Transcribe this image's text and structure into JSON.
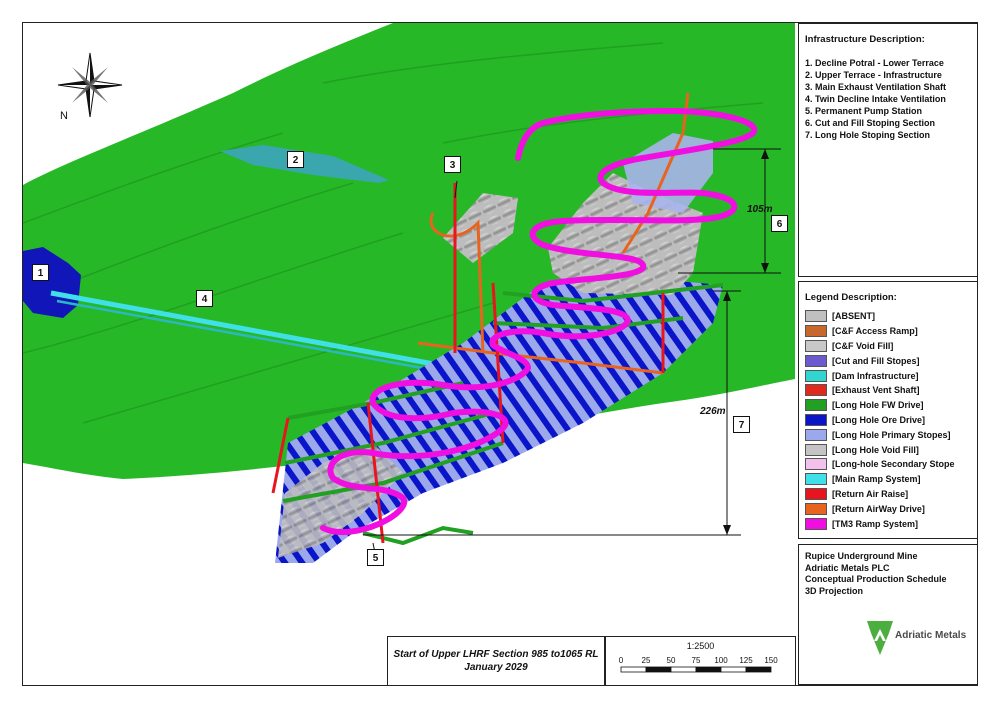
{
  "infrastructure": {
    "title": "Infrastructure Description:",
    "items": [
      "1. Decline Potral - Lower Terrace",
      "2. Upper Terrace - Infrastructure",
      "3. Main Exhaust Ventilation Shaft",
      "4. Twin Decline Intake Ventilation",
      "5. Permanent Pump Station",
      "6. Cut and Fill Stoping Section",
      "7. Long Hole Stoping Section"
    ]
  },
  "legend": {
    "title": "Legend Description:",
    "items": [
      {
        "label": "[ABSENT]",
        "color": "#c0c0c0"
      },
      {
        "label": "[C&F Access Ramp]",
        "color": "#c8682a"
      },
      {
        "label": "[C&F Void Fill]",
        "color": "#c8c8c8"
      },
      {
        "label": "[Cut and Fill Stopes]",
        "color": "#6a5acd"
      },
      {
        "label": "[Dam Infrastructure]",
        "color": "#30d6d0"
      },
      {
        "label": "[Exhaust Vent Shaft]",
        "color": "#e0281e"
      },
      {
        "label": "[Long Hole FW Drive]",
        "color": "#22a022"
      },
      {
        "label": "[Long Hole Ore Drive]",
        "color": "#0a14c8"
      },
      {
        "label": "[Long Hole Primary Stopes]",
        "color": "#9ca8ec"
      },
      {
        "label": "[Long Hole Void Fill]",
        "color": "#c4c4c4"
      },
      {
        "label": "[Long-hole Secondary Stope",
        "color": "#f2c2ec"
      },
      {
        "label": "[Main Ramp System]",
        "color": "#40e0e8"
      },
      {
        "label": "[Return Air Raise]",
        "color": "#e8141e"
      },
      {
        "label": "[Return AirWay Drive]",
        "color": "#e8641e"
      },
      {
        "label": "[TM3 Ramp System]",
        "color": "#f00ee0"
      }
    ]
  },
  "company": {
    "lines": [
      "Rupice Underground Mine",
      "Adriatic Metals PLC",
      "Conceptual Production Schedule",
      "3D Projection"
    ],
    "logo_text": "Adriatic Metals"
  },
  "title_block": {
    "line1": "Start of Upper LHRF Section 985 to1065 RL",
    "line2": "January 2029"
  },
  "scale": {
    "label": "1:2500",
    "ticks": [
      "0",
      "25",
      "50",
      "75",
      "100",
      "125",
      "150"
    ]
  },
  "map": {
    "north_label": "N",
    "callouts": [
      "1",
      "2",
      "3",
      "4",
      "5",
      "6",
      "7"
    ],
    "dimension_cf": "105m",
    "dimension_lh": "226m"
  },
  "colors": {
    "terrain": "#27b827",
    "terrain_dark": "#1f9a1f",
    "tm3_ramp": "#f00ee0",
    "main_ramp": "#40e0e8",
    "ore_drive": "#0a14c8",
    "fw_drive": "#22a022",
    "return_air": "#e8141e",
    "access_ramp": "#c8682a",
    "void_fill": "#a8a8a8",
    "primary_stopes": "#9ca8ec"
  }
}
